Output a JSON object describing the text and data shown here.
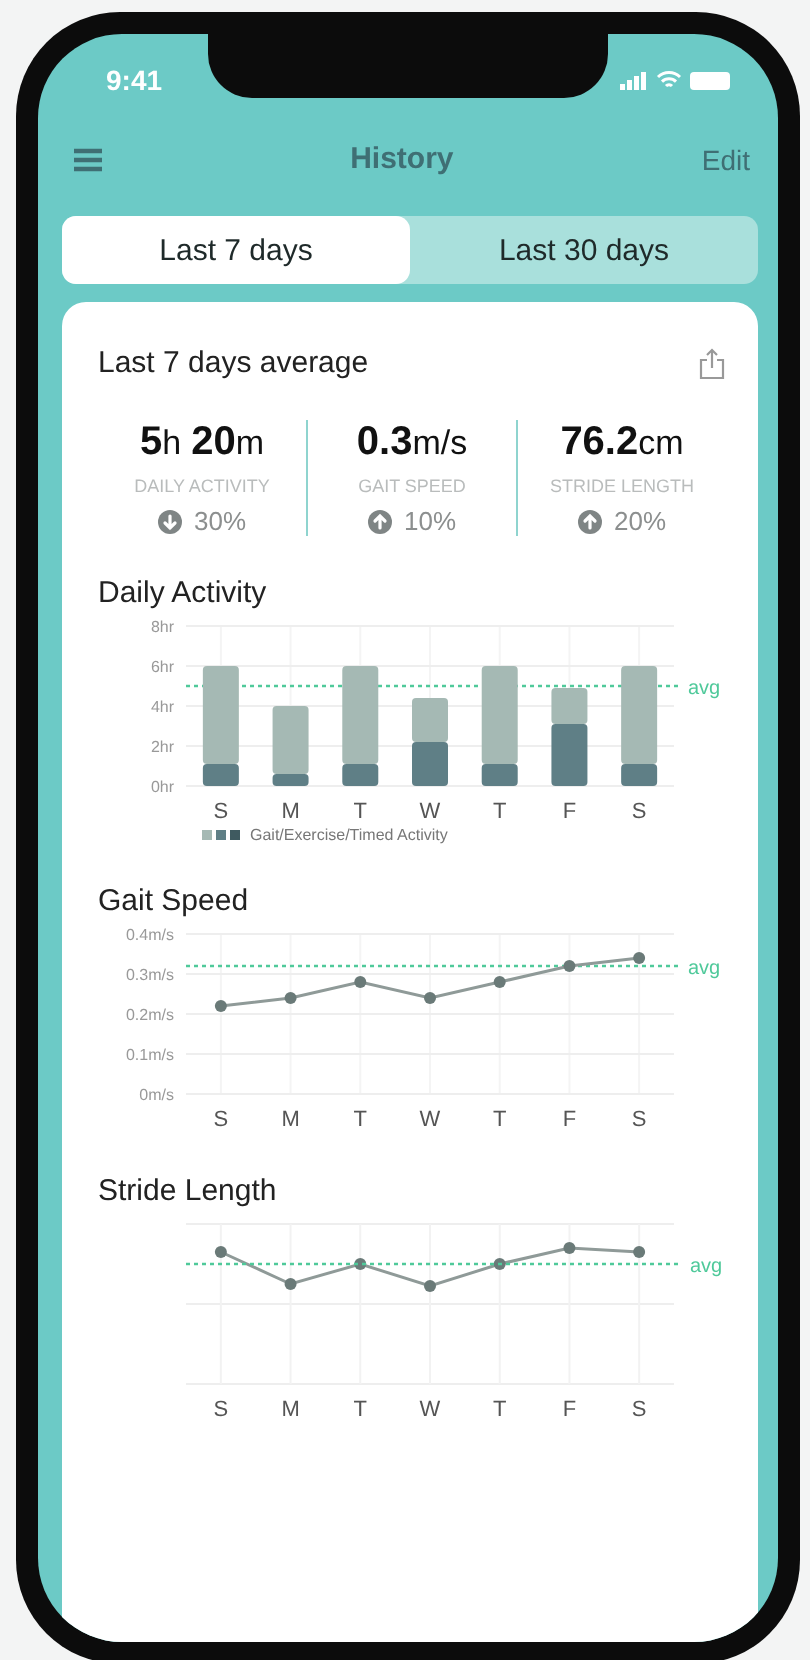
{
  "status_bar": {
    "time": "9:41"
  },
  "header": {
    "title": "History",
    "action": "Edit"
  },
  "tabs": [
    {
      "label": "Last 7 days",
      "selected": true
    },
    {
      "label": "Last 30 days",
      "selected": false
    }
  ],
  "summary": {
    "title": "Last 7 days average",
    "stats": [
      {
        "parts": [
          {
            "number": "5",
            "unit": "h"
          },
          {
            "number": "20",
            "unit": "m"
          }
        ],
        "label": "DAILY ACTIVITY",
        "kind": "down",
        "change": "30%"
      },
      {
        "parts": [
          {
            "number": "0.3",
            "unit": "m/s"
          }
        ],
        "label": "GAIT SPEED",
        "kind": "up",
        "change": "10%"
      },
      {
        "parts": [
          {
            "number": "76.2",
            "unit": "cm"
          }
        ],
        "label": "STRIDE LENGTH",
        "kind": "up",
        "change": "20%"
      }
    ]
  },
  "daily_activity": {
    "title": "Daily Activity",
    "chart_data": {
      "type": "bar",
      "stacked": true,
      "grid": true,
      "categories": [
        "S",
        "M",
        "T",
        "W",
        "T",
        "F",
        "S"
      ],
      "ylim": [
        0,
        8
      ],
      "yticks": [
        {
          "value": 0,
          "label": "0hr"
        },
        {
          "value": 2,
          "label": "2hr"
        },
        {
          "value": 4,
          "label": "4hr"
        },
        {
          "value": 6,
          "label": "6hr"
        },
        {
          "value": 8,
          "label": "8hr"
        }
      ],
      "series": [
        {
          "name": "Gait/Exercise/Timed Activity",
          "color": "#5f7f86",
          "values": [
            1.1,
            0.6,
            1.1,
            2.2,
            1.1,
            3.1,
            1.1
          ]
        },
        {
          "color": "#a5b9b4",
          "values": [
            4.9,
            3.4,
            4.9,
            2.2,
            4.9,
            1.8,
            4.9
          ]
        }
      ],
      "ref_lines": [
        {
          "axis": "y",
          "value": 5,
          "label": "avg",
          "color": "#4fc99a"
        }
      ]
    }
  },
  "gait_speed": {
    "title": "Gait Speed",
    "chart_data": {
      "type": "line",
      "grid": true,
      "categories": [
        "S",
        "M",
        "T",
        "W",
        "T",
        "F",
        "S"
      ],
      "ylim": [
        0,
        0.4
      ],
      "yticks": [
        {
          "value": 0,
          "label": "0m/s"
        },
        {
          "value": 0.1,
          "label": "0.1m/s"
        },
        {
          "value": 0.2,
          "label": "0.2m/s"
        },
        {
          "value": 0.3,
          "label": "0.3m/s"
        },
        {
          "value": 0.4,
          "label": "0.4m/s"
        }
      ],
      "series": [
        {
          "color": "#8f9a98",
          "marker": "o",
          "values": [
            0.22,
            0.24,
            0.28,
            0.24,
            0.28,
            0.32,
            0.34
          ]
        }
      ],
      "ref_lines": [
        {
          "axis": "y",
          "value": 0.32,
          "label": "avg",
          "color": "#4fc99a"
        }
      ]
    }
  },
  "stride_length": {
    "title": "Stride Length",
    "days": [
      "S",
      "M",
      "T",
      "W",
      "T",
      "F",
      "S"
    ],
    "avg_label": "avg"
  }
}
